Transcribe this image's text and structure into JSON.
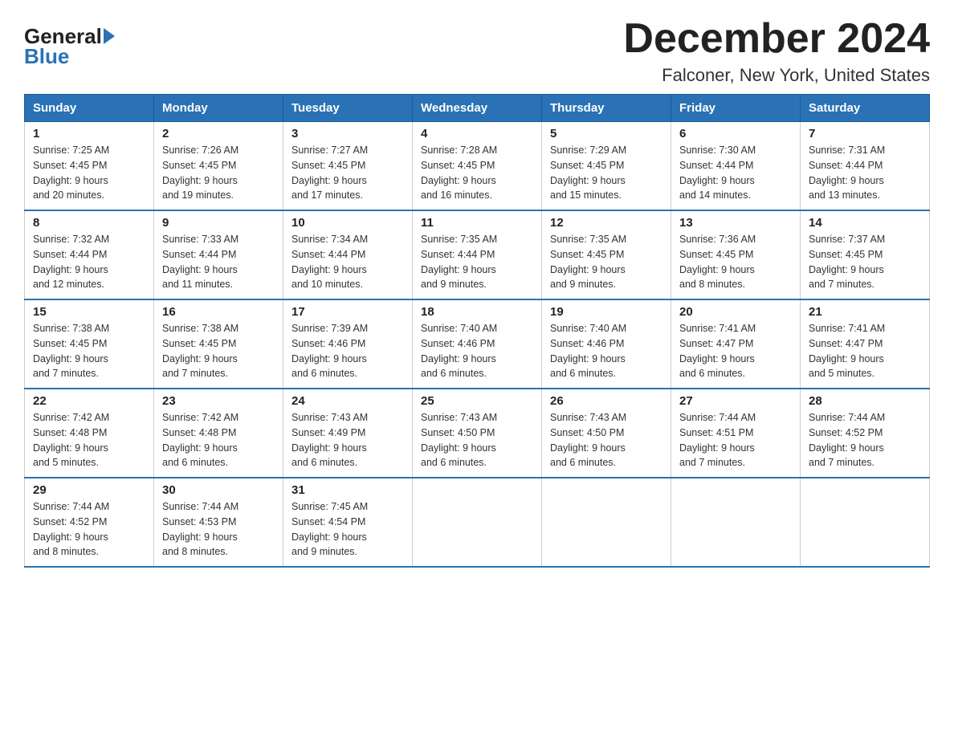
{
  "header": {
    "logo_line1": "General",
    "logo_line2": "Blue",
    "title": "December 2024",
    "subtitle": "Falconer, New York, United States"
  },
  "calendar": {
    "days_of_week": [
      "Sunday",
      "Monday",
      "Tuesday",
      "Wednesday",
      "Thursday",
      "Friday",
      "Saturday"
    ],
    "weeks": [
      [
        {
          "num": "1",
          "sunrise": "7:25 AM",
          "sunset": "4:45 PM",
          "daylight": "9 hours and 20 minutes."
        },
        {
          "num": "2",
          "sunrise": "7:26 AM",
          "sunset": "4:45 PM",
          "daylight": "9 hours and 19 minutes."
        },
        {
          "num": "3",
          "sunrise": "7:27 AM",
          "sunset": "4:45 PM",
          "daylight": "9 hours and 17 minutes."
        },
        {
          "num": "4",
          "sunrise": "7:28 AM",
          "sunset": "4:45 PM",
          "daylight": "9 hours and 16 minutes."
        },
        {
          "num": "5",
          "sunrise": "7:29 AM",
          "sunset": "4:45 PM",
          "daylight": "9 hours and 15 minutes."
        },
        {
          "num": "6",
          "sunrise": "7:30 AM",
          "sunset": "4:44 PM",
          "daylight": "9 hours and 14 minutes."
        },
        {
          "num": "7",
          "sunrise": "7:31 AM",
          "sunset": "4:44 PM",
          "daylight": "9 hours and 13 minutes."
        }
      ],
      [
        {
          "num": "8",
          "sunrise": "7:32 AM",
          "sunset": "4:44 PM",
          "daylight": "9 hours and 12 minutes."
        },
        {
          "num": "9",
          "sunrise": "7:33 AM",
          "sunset": "4:44 PM",
          "daylight": "9 hours and 11 minutes."
        },
        {
          "num": "10",
          "sunrise": "7:34 AM",
          "sunset": "4:44 PM",
          "daylight": "9 hours and 10 minutes."
        },
        {
          "num": "11",
          "sunrise": "7:35 AM",
          "sunset": "4:44 PM",
          "daylight": "9 hours and 9 minutes."
        },
        {
          "num": "12",
          "sunrise": "7:35 AM",
          "sunset": "4:45 PM",
          "daylight": "9 hours and 9 minutes."
        },
        {
          "num": "13",
          "sunrise": "7:36 AM",
          "sunset": "4:45 PM",
          "daylight": "9 hours and 8 minutes."
        },
        {
          "num": "14",
          "sunrise": "7:37 AM",
          "sunset": "4:45 PM",
          "daylight": "9 hours and 7 minutes."
        }
      ],
      [
        {
          "num": "15",
          "sunrise": "7:38 AM",
          "sunset": "4:45 PM",
          "daylight": "9 hours and 7 minutes."
        },
        {
          "num": "16",
          "sunrise": "7:38 AM",
          "sunset": "4:45 PM",
          "daylight": "9 hours and 7 minutes."
        },
        {
          "num": "17",
          "sunrise": "7:39 AM",
          "sunset": "4:46 PM",
          "daylight": "9 hours and 6 minutes."
        },
        {
          "num": "18",
          "sunrise": "7:40 AM",
          "sunset": "4:46 PM",
          "daylight": "9 hours and 6 minutes."
        },
        {
          "num": "19",
          "sunrise": "7:40 AM",
          "sunset": "4:46 PM",
          "daylight": "9 hours and 6 minutes."
        },
        {
          "num": "20",
          "sunrise": "7:41 AM",
          "sunset": "4:47 PM",
          "daylight": "9 hours and 6 minutes."
        },
        {
          "num": "21",
          "sunrise": "7:41 AM",
          "sunset": "4:47 PM",
          "daylight": "9 hours and 5 minutes."
        }
      ],
      [
        {
          "num": "22",
          "sunrise": "7:42 AM",
          "sunset": "4:48 PM",
          "daylight": "9 hours and 5 minutes."
        },
        {
          "num": "23",
          "sunrise": "7:42 AM",
          "sunset": "4:48 PM",
          "daylight": "9 hours and 6 minutes."
        },
        {
          "num": "24",
          "sunrise": "7:43 AM",
          "sunset": "4:49 PM",
          "daylight": "9 hours and 6 minutes."
        },
        {
          "num": "25",
          "sunrise": "7:43 AM",
          "sunset": "4:50 PM",
          "daylight": "9 hours and 6 minutes."
        },
        {
          "num": "26",
          "sunrise": "7:43 AM",
          "sunset": "4:50 PM",
          "daylight": "9 hours and 6 minutes."
        },
        {
          "num": "27",
          "sunrise": "7:44 AM",
          "sunset": "4:51 PM",
          "daylight": "9 hours and 7 minutes."
        },
        {
          "num": "28",
          "sunrise": "7:44 AM",
          "sunset": "4:52 PM",
          "daylight": "9 hours and 7 minutes."
        }
      ],
      [
        {
          "num": "29",
          "sunrise": "7:44 AM",
          "sunset": "4:52 PM",
          "daylight": "9 hours and 8 minutes."
        },
        {
          "num": "30",
          "sunrise": "7:44 AM",
          "sunset": "4:53 PM",
          "daylight": "9 hours and 8 minutes."
        },
        {
          "num": "31",
          "sunrise": "7:45 AM",
          "sunset": "4:54 PM",
          "daylight": "9 hours and 9 minutes."
        },
        null,
        null,
        null,
        null
      ]
    ]
  }
}
